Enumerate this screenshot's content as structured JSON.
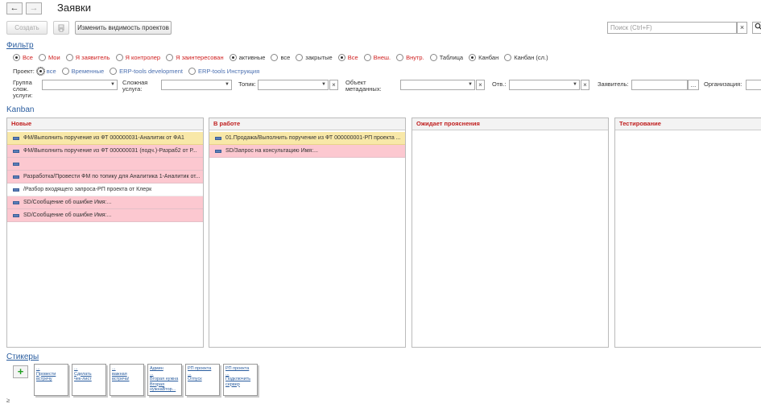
{
  "window": {
    "title": "Заявки",
    "back_glyph": "←",
    "forward_glyph": "→"
  },
  "toolbar": {
    "create_label": "Создать",
    "visibility_label": "Изменить видимость проектов",
    "search_placeholder": "Поиск (Ctrl+F)",
    "clear_glyph": "×"
  },
  "filter": {
    "title": "Фильтр",
    "options_row1": [
      {
        "label": "Все",
        "selected": true,
        "color": "red"
      },
      {
        "label": "Мои",
        "selected": false,
        "color": "red"
      },
      {
        "label": "Я заявитель",
        "selected": false,
        "color": "red"
      },
      {
        "label": "Я контролер",
        "selected": false,
        "color": "red"
      },
      {
        "label": "Я заинтересован",
        "selected": false,
        "color": "red"
      },
      {
        "label": "активные",
        "selected": true,
        "color": "dark"
      },
      {
        "label": "все",
        "selected": false,
        "color": "dark"
      },
      {
        "label": "закрытые",
        "selected": false,
        "color": "dark"
      },
      {
        "label": "Все",
        "selected": true,
        "color": "red"
      },
      {
        "label": "Внеш.",
        "selected": false,
        "color": "red"
      },
      {
        "label": "Внутр.",
        "selected": false,
        "color": "red"
      },
      {
        "label": "Таблица",
        "selected": false,
        "color": "dark"
      },
      {
        "label": "Канбан",
        "selected": true,
        "color": "dark"
      },
      {
        "label": "Канбан (сл.)",
        "selected": false,
        "color": "dark"
      }
    ],
    "project_label": "Проект:",
    "options_row2": [
      {
        "label": "все",
        "selected": true
      },
      {
        "label": "Временные",
        "selected": false
      },
      {
        "label": "ERP-tools development",
        "selected": false
      },
      {
        "label": "ERP-tools Инструкция",
        "selected": false
      }
    ],
    "fields": {
      "group": "Группа слож. услуги:",
      "complex": "Сложная услуга:",
      "topic": "Топик:",
      "metadata": "Объект метаданных:",
      "resp": "Отв.:",
      "applicant": "Заявитель:",
      "org": "Организация:"
    },
    "dots": "..."
  },
  "kanban": {
    "title": "Kanban",
    "columns": [
      {
        "title": "Новые",
        "cards": [
          {
            "text": "ФМ/Выполнить поручение из ФТ 000000031-Аналитик от ФА1",
            "color": "yellow"
          },
          {
            "text": "ФМ/Выполнить поручение из ФТ 000000031 (подч.)-Разраб2 от Р...",
            "color": "pink"
          },
          {
            "text": "",
            "color": "pink"
          },
          {
            "text": "Разработка/Провести ФМ по топику для Аналитика 1-Аналитик от...",
            "color": "pink"
          },
          {
            "text": "/Разбор входящего запроса-РП проекта от Клерк",
            "color": "white"
          },
          {
            "text": "SD/Сообщение об ошибке Имя:...",
            "color": "pink"
          },
          {
            "text": "SD/Сообщение об ошибке Имя:...",
            "color": "pink"
          }
        ]
      },
      {
        "title": "В работе",
        "cards": [
          {
            "text": "01.Продажа/Выполнить поручение из ФТ 000000001-РП проекта ...",
            "color": "yellow"
          },
          {
            "text": "SD/Запрос на консультацию Имя:...",
            "color": "pink"
          }
        ]
      },
      {
        "title": "Ожидает прояснения",
        "cards": []
      },
      {
        "title": "Тестирование",
        "cards": []
      }
    ]
  },
  "stickers": {
    "title": "Стикеры",
    "add_glyph": "+",
    "items": [
      {
        "lines": [
          "...",
          "Провести",
          "встречу"
        ]
      },
      {
        "lines": [
          "...",
          "Сделать",
          "чек-лист"
        ]
      },
      {
        "lines": [
          "...",
          "важная",
          "встреча!"
        ]
      },
      {
        "lines": [
          "Админ",
          "...",
          "Вторая нужна",
          "Вторая",
          "нужнаВтор..."
        ]
      },
      {
        "lines": [
          "РП проекта",
          "...",
          "Отпуск"
        ]
      },
      {
        "lines": [
          "РП проекта",
          "...",
          "Подключить",
          "сервер"
        ]
      }
    ]
  },
  "footer": {
    "mark": "≥"
  }
}
